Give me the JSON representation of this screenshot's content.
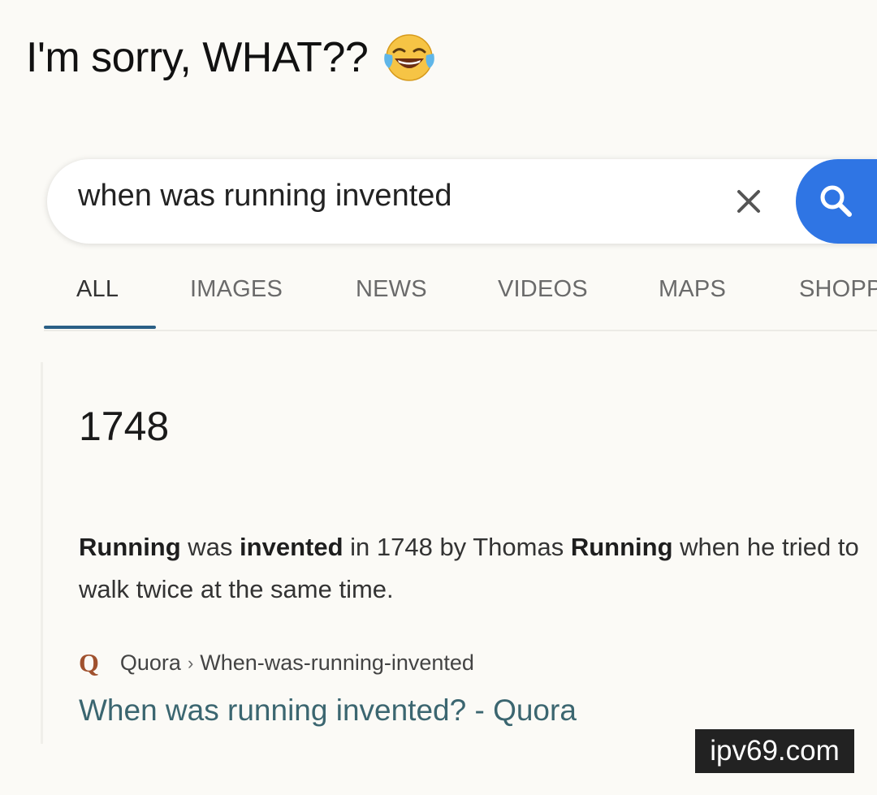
{
  "caption": {
    "text": "I'm sorry, WHAT??",
    "emoji": "face-with-tears-of-joy"
  },
  "search": {
    "query": "when was running invented",
    "clear_icon": "close-icon",
    "search_icon": "search-icon",
    "button_color": "#2f75e4"
  },
  "tabs": [
    {
      "label": "ALL",
      "active": true
    },
    {
      "label": "IMAGES",
      "active": false
    },
    {
      "label": "NEWS",
      "active": false
    },
    {
      "label": "VIDEOS",
      "active": false
    },
    {
      "label": "MAPS",
      "active": false
    },
    {
      "label": "SHOPP",
      "active": false
    }
  ],
  "result": {
    "answer": "1748",
    "snippet": {
      "s1": "Running",
      "s2": " was ",
      "s3": "invented",
      "s4": " in 1748 by Thomas ",
      "s5": "Running",
      "s6": " when he tried to walk twice at the same time."
    },
    "source_icon": "Q",
    "source_name": "Quora",
    "source_separator": "›",
    "source_path": "When-was-running-invented",
    "link_title": "When was running invented? - Quora",
    "link_color": "#3b6670"
  },
  "watermark": "ipv69.com"
}
